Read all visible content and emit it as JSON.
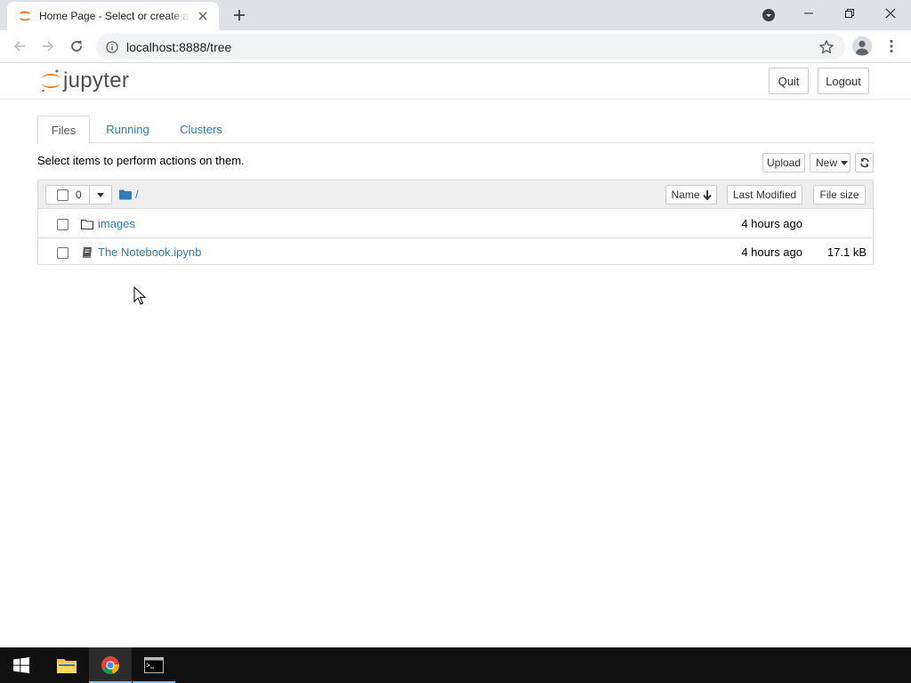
{
  "browser": {
    "tab_title": "Home Page - Select or create a n",
    "url": "localhost:8888/tree",
    "icons": {
      "favicon": "jupyter-favicon",
      "tab_close": "close-icon",
      "new_tab": "plus-icon",
      "tab_search": "chevron-down-circle-icon",
      "minimize": "minimize-icon",
      "maximize": "restore-icon",
      "close": "close-icon",
      "back": "arrow-left-icon",
      "forward": "arrow-right-icon",
      "reload": "reload-icon",
      "info": "info-icon",
      "bookmark": "star-icon",
      "profile": "account-icon",
      "menu": "kebab-menu-icon"
    }
  },
  "jupyter": {
    "logo_text": "jupyter",
    "quit_label": "Quit",
    "logout_label": "Logout",
    "tabs": [
      {
        "label": "Files",
        "active": true
      },
      {
        "label": "Running",
        "active": false
      },
      {
        "label": "Clusters",
        "active": false
      }
    ],
    "instruction": "Select items to perform actions on them.",
    "upload_label": "Upload",
    "new_label": "New",
    "refresh_icon": "refresh-icon",
    "selected_count": "0",
    "breadcrumb": "/",
    "columns": {
      "name": "Name",
      "last_modified": "Last Modified",
      "file_size": "File size"
    },
    "rows": [
      {
        "name": "images",
        "icon": "folder-icon",
        "modified": "4 hours ago",
        "size": ""
      },
      {
        "name": "The Notebook.ipynb",
        "icon": "notebook-icon",
        "modified": "4 hours ago",
        "size": "17.1 kB"
      }
    ]
  },
  "taskbar": {
    "items": [
      {
        "icon": "windows-start-icon"
      },
      {
        "icon": "file-explorer-icon"
      },
      {
        "icon": "chrome-icon",
        "active": true
      },
      {
        "icon": "terminal-icon",
        "running": true
      }
    ]
  },
  "colors": {
    "link": "#337ab7",
    "jupyter_orange": "#f37726",
    "taskbar": "#101010"
  }
}
